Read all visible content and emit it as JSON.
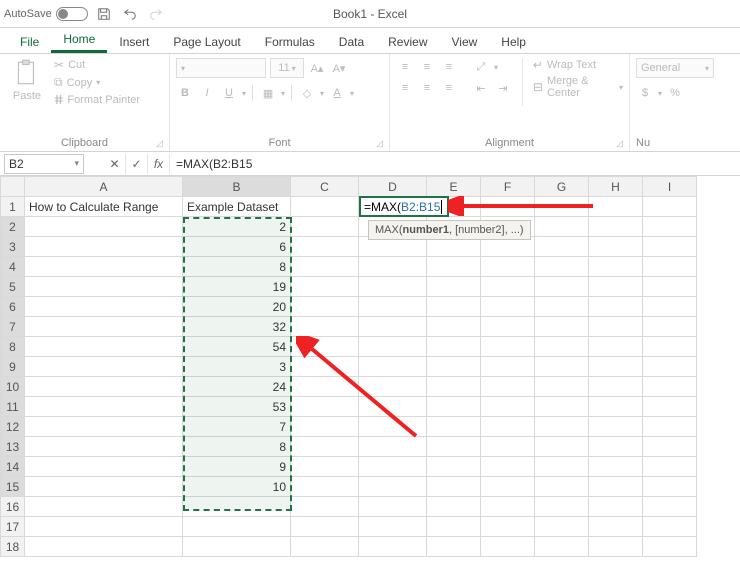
{
  "titlebar": {
    "autosave_label": "AutoSave",
    "autosave_state": "Off",
    "document_title": "Book1 - Excel"
  },
  "tabs": {
    "file": "File",
    "home": "Home",
    "insert": "Insert",
    "page_layout": "Page Layout",
    "formulas": "Formulas",
    "data": "Data",
    "review": "Review",
    "view": "View",
    "help": "Help"
  },
  "ribbon": {
    "clipboard": {
      "paste": "Paste",
      "cut": "Cut",
      "copy": "Copy",
      "format_painter": "Format Painter",
      "group": "Clipboard"
    },
    "font": {
      "size": "11",
      "bold": "B",
      "italic": "I",
      "underline": "U",
      "group": "Font"
    },
    "alignment": {
      "wrap": "Wrap Text",
      "merge": "Merge & Center",
      "group": "Alignment"
    },
    "number": {
      "format": "General",
      "group": "Nu"
    }
  },
  "formula_bar": {
    "name_box": "B2",
    "formula": "=MAX(B2:B15"
  },
  "columns": [
    "A",
    "B",
    "C",
    "D",
    "E",
    "F",
    "G",
    "H",
    "I"
  ],
  "rows": [
    1,
    2,
    3,
    4,
    5,
    6,
    7,
    8,
    9,
    10,
    11,
    12,
    13,
    14,
    15,
    16,
    17,
    18
  ],
  "cells": {
    "A1": "How to Calculate Range",
    "B1": "Example Dataset",
    "B2": "2",
    "B3": "6",
    "B4": "8",
    "B5": "19",
    "B6": "20",
    "B7": "32",
    "B8": "54",
    "B9": "3",
    "B10": "24",
    "B11": "53",
    "B12": "7",
    "B13": "8",
    "B14": "9",
    "B15": "10"
  },
  "editing": {
    "cell": "D1",
    "display_prefix": "=MAX(",
    "display_ref": "B2:B15",
    "tooltip_fn": "MAX(",
    "tooltip_bold": "number1",
    "tooltip_rest": ", [number2], ...)"
  }
}
